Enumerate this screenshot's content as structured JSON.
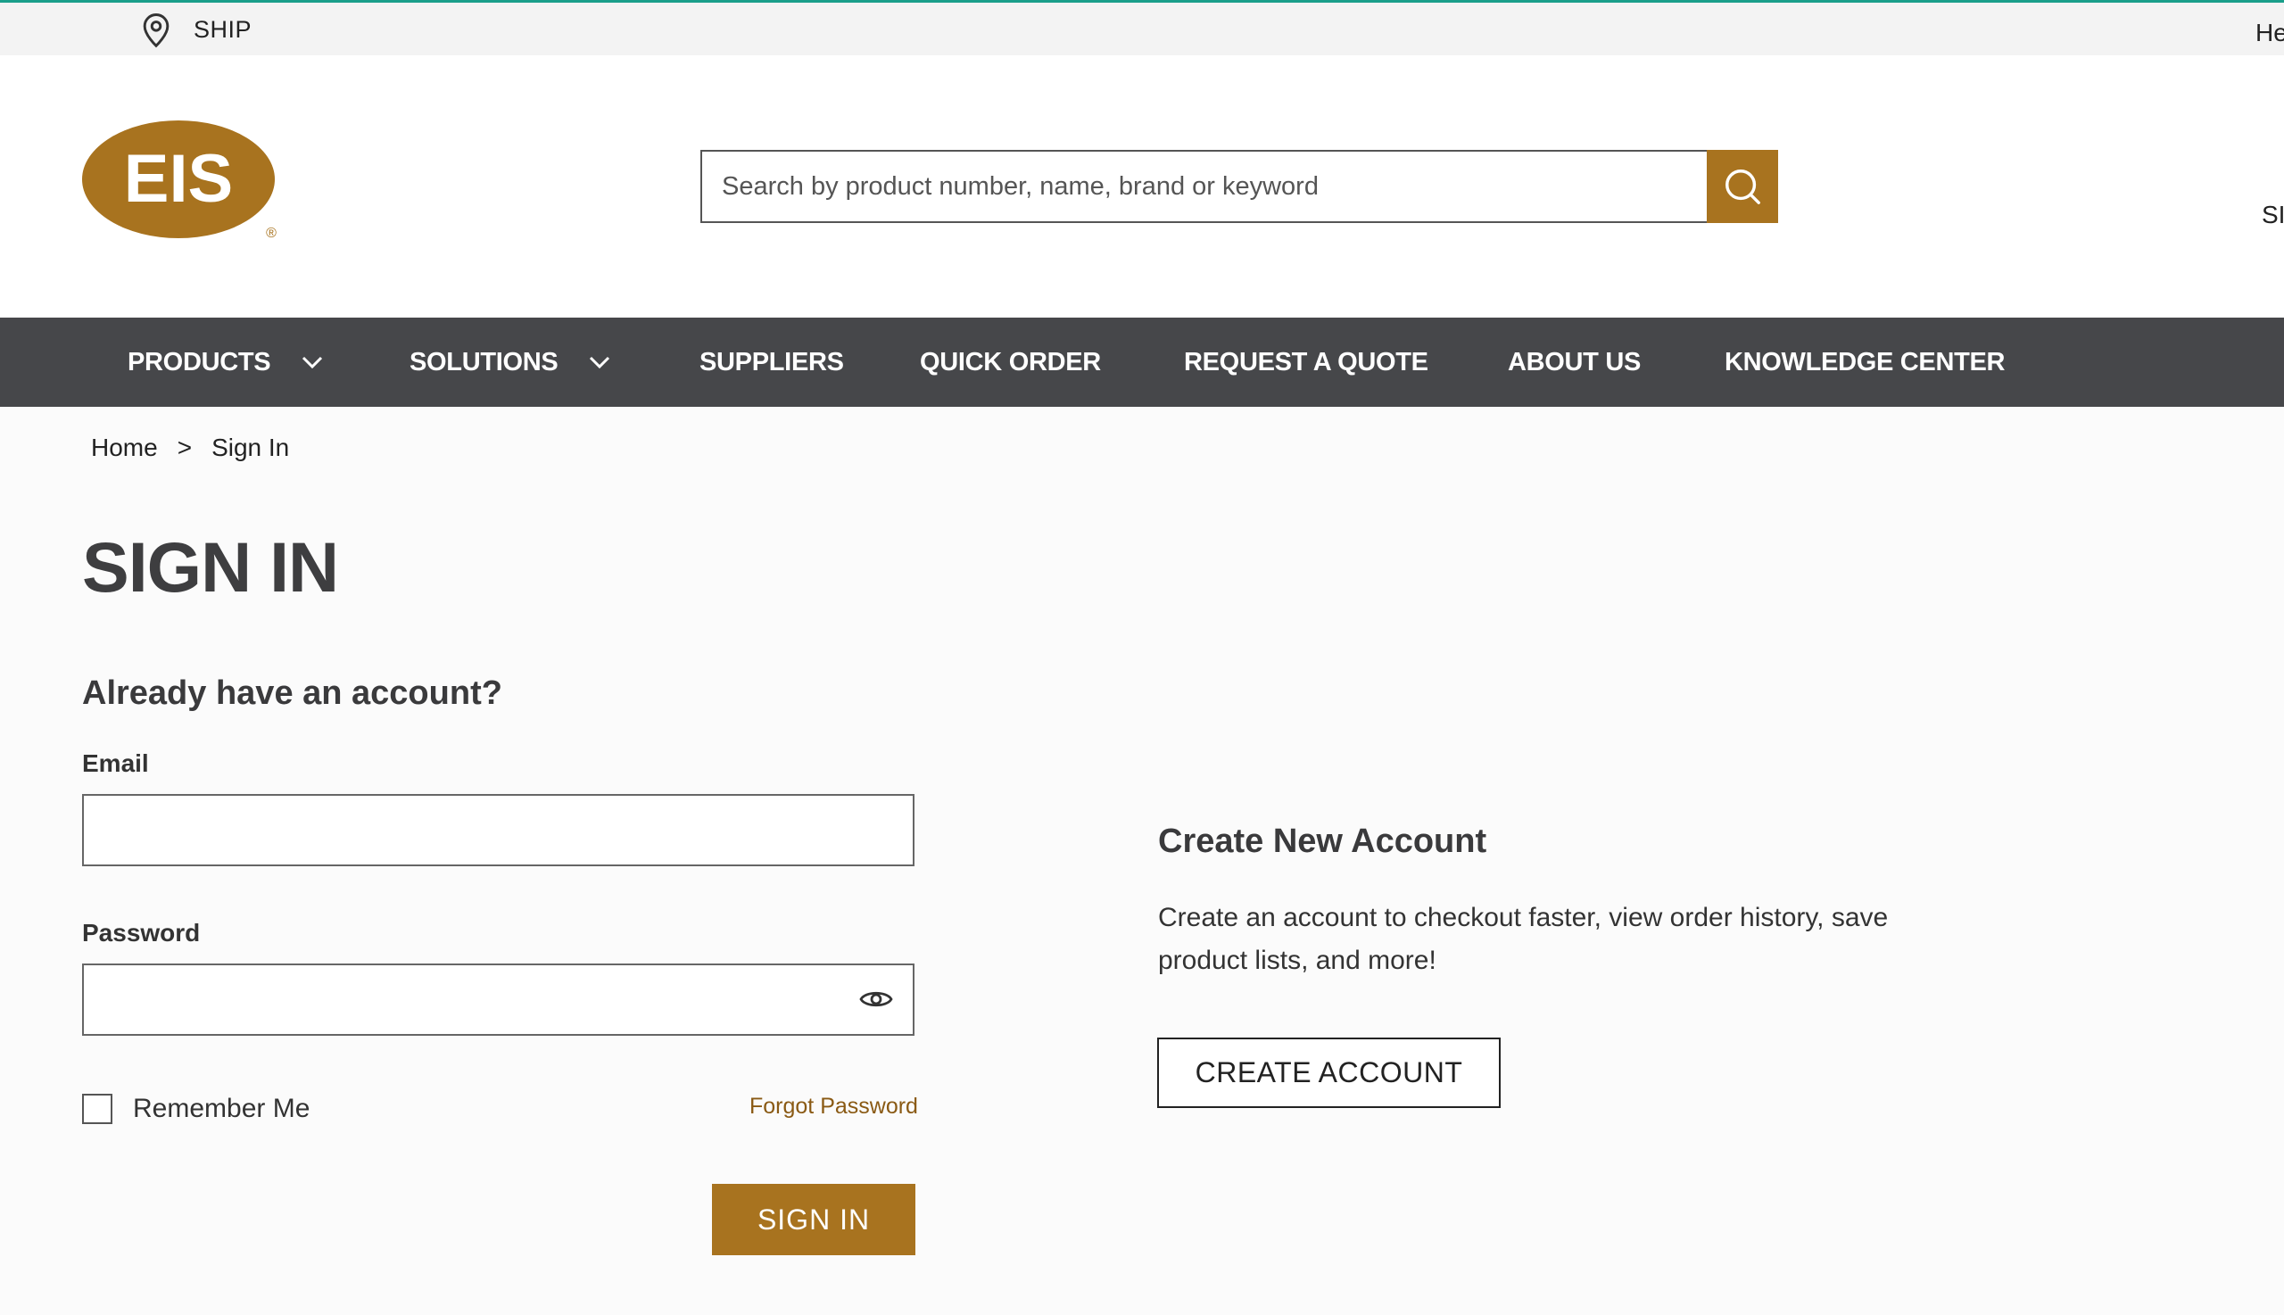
{
  "topbar": {
    "ship_label": "SHIP",
    "help_label": "He"
  },
  "logo": {
    "text": "EIS",
    "registered": "®",
    "brand_color": "#a8731f"
  },
  "search": {
    "placeholder": "Search by product number, name, brand or keyword",
    "value": ""
  },
  "header": {
    "signin_label": "SI"
  },
  "nav": {
    "items": [
      {
        "label": "PRODUCTS"
      },
      {
        "label": "SOLUTIONS"
      },
      {
        "label": "SUPPLIERS"
      },
      {
        "label": "QUICK ORDER"
      },
      {
        "label": "REQUEST A QUOTE"
      },
      {
        "label": "ABOUT US"
      },
      {
        "label": "KNOWLEDGE CENTER"
      }
    ]
  },
  "breadcrumb": {
    "home": "Home",
    "separator": ">",
    "current": "Sign In"
  },
  "page": {
    "title": "SIGN IN"
  },
  "login": {
    "heading": "Already have an account?",
    "email_label": "Email",
    "email_value": "",
    "password_label": "Password",
    "password_value": "",
    "remember_label": "Remember Me",
    "forgot_label": "Forgot Password",
    "submit_label": "SIGN IN"
  },
  "create": {
    "heading": "Create New Account",
    "description": "Create an account to checkout faster, view order history, save product lists, and more!",
    "button_label": "CREATE ACCOUNT"
  },
  "colors": {
    "accent": "#a8731f",
    "nav_bg": "#46474a",
    "top_border": "#1a9e8a"
  }
}
